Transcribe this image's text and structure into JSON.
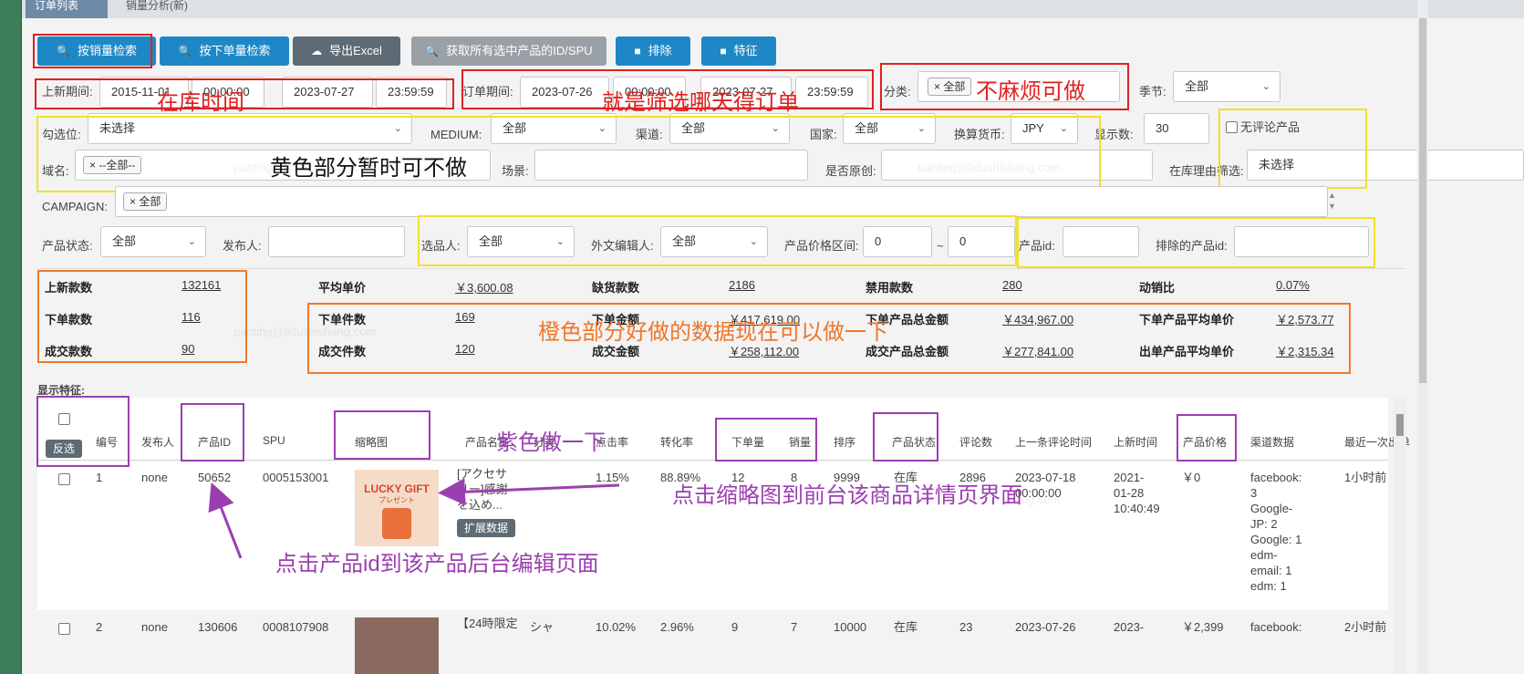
{
  "tabs": {
    "order_list": "订单列表",
    "sales_analysis": "销量分析(新)"
  },
  "toolbar": {
    "by_sales": "按销量检索",
    "by_orders": "按下单量检索",
    "export": "导出Excel",
    "get_ids": "获取所有选中产品的ID/SPU",
    "sort": "排除",
    "feature": "特征"
  },
  "filters": {
    "new_period_label": "上新期间:",
    "new_start_date": "2015-11-01",
    "new_start_time": "00:00:00",
    "new_end_date": "2023-07-27",
    "new_end_time": "23:59:59",
    "order_period_label": "订单期间:",
    "order_start_date": "2023-07-26",
    "order_start_time": "00:00:00",
    "order_end_date": "2023-07-27",
    "order_end_time": "23:59:59",
    "category_label": "分类:",
    "category_tag": "全部",
    "season_label": "季节:",
    "season_value": "全部",
    "check_label": "勾选位:",
    "check_value": "未选择",
    "medium_label": "MEDIUM:",
    "medium_value": "全部",
    "channel_label": "渠道:",
    "channel_value": "全部",
    "country_label": "国家:",
    "country_value": "全部",
    "currency_label": "换算货币:",
    "currency_value": "JPY",
    "display_label": "显示数:",
    "display_value": "30",
    "no_review_label": "无评论产品",
    "domain_label": "域名:",
    "domain_tag": "--全部--",
    "scene_label": "场景:",
    "original_label": "是否原创:",
    "stock_reason_label": "在库理由筛选:",
    "stock_reason_value": "未选择",
    "campaign_label": "CAMPAIGN:",
    "campaign_tag": "全部",
    "status_label": "产品状态:",
    "status_value": "全部",
    "publisher_label": "发布人:",
    "picker_label": "选品人:",
    "picker_value": "全部",
    "editor_label": "外文编辑人:",
    "editor_value": "全部",
    "price_label": "产品价格区间:",
    "price_min": "0",
    "price_sep": "~",
    "price_max": "0",
    "pid_label": "产品id:",
    "exclude_label": "排除的产品id:"
  },
  "stats": [
    {
      "label": "上新款数",
      "value": "132161"
    },
    {
      "label": "平均单价",
      "value": "￥3,600.08"
    },
    {
      "label": "缺货款数",
      "value": "2186"
    },
    {
      "label": "禁用款数",
      "value": "280"
    },
    {
      "label": "动销比",
      "value": "0.07%"
    },
    {
      "label": "下单款数",
      "value": "116"
    },
    {
      "label": "下单件数",
      "value": "169"
    },
    {
      "label": "下单金额",
      "value": "￥417,619.00"
    },
    {
      "label": "下单产品总金额",
      "value": "￥434,967.00"
    },
    {
      "label": "下单产品平均单价",
      "value": "￥2,573.77"
    },
    {
      "label": "成交款数",
      "value": "90"
    },
    {
      "label": "成交件数",
      "value": "120"
    },
    {
      "label": "成交金额",
      "value": "￥258,112.00"
    },
    {
      "label": "成交产品总金额",
      "value": "￥277,841.00"
    },
    {
      "label": "出单产品平均单价",
      "value": "￥2,315.34"
    }
  ],
  "features_label": "显示特征:",
  "invert_label": "反选",
  "columns": [
    "编号",
    "发布人",
    "产品ID",
    "SPU",
    "缩略图",
    "产品名称",
    "分类",
    "点击率",
    "转化率",
    "下单量",
    "销量",
    "排序",
    "产品状态",
    "评论数",
    "上一条评论时间",
    "上新时间",
    "产品价格",
    "渠道数据",
    "最近一次出单"
  ],
  "rows": [
    {
      "no": "1",
      "publisher": "none",
      "pid": "50652",
      "spu": "0005153001",
      "name": [
        "[アクセサ",
        "リー]感謝",
        "を込め..."
      ],
      "ext": "扩展数据",
      "click": "1.15%",
      "conv": "88.89%",
      "orders": "12",
      "sales": "8",
      "rank": "9999",
      "status": "在库",
      "reviews": "2896",
      "last_review": [
        "2023-07-18",
        "00:00:00"
      ],
      "new_time": [
        "2021-",
        "01-28",
        "10:40:49"
      ],
      "price": "￥0",
      "channel": [
        "facebook:",
        "3",
        "Google-",
        "JP: 2",
        "Google: 1",
        "edm-",
        "email: 1",
        "edm: 1"
      ],
      "last_order": "1小时前",
      "thumb_text": "LUCKY GIFT",
      "thumb_sub": "プレゼント"
    },
    {
      "no": "2",
      "publisher": "none",
      "pid": "130606",
      "spu": "0008107908",
      "name": [
        "【24時限定"
      ],
      "cat": "シャ",
      "click": "10.02%",
      "conv": "2.96%",
      "orders": "9",
      "sales": "7",
      "rank": "10000",
      "status": "在库",
      "reviews": "23",
      "last_review": [
        "2023-07-26"
      ],
      "new_time": [
        "2023-"
      ],
      "price": "￥2,399",
      "channel": [
        "facebook:"
      ],
      "last_order": "2小时前"
    }
  ],
  "annotations": {
    "stock_time": "在库时间",
    "filter_day": "就是筛选哪天得订单",
    "category_ok": "不麻烦可做",
    "yellow_note": "黄色部分暂时可不做",
    "orange_note": "橙色部分好做的数据现在可以做一下",
    "purple_note": "紫色做一下",
    "thumb_note": "点击缩略图到前台该商品详情页界面",
    "pid_note": "点击产品id到该产品后台编辑页面"
  },
  "watermark": "panting@lidushishang.com",
  "colors": {
    "annotation_red": "#e02020",
    "annotation_yellow": "#f2e02a",
    "annotation_orange": "#f07a2b",
    "annotation_purple": "#9b3fb0",
    "button_blue": "#1e88c7"
  }
}
